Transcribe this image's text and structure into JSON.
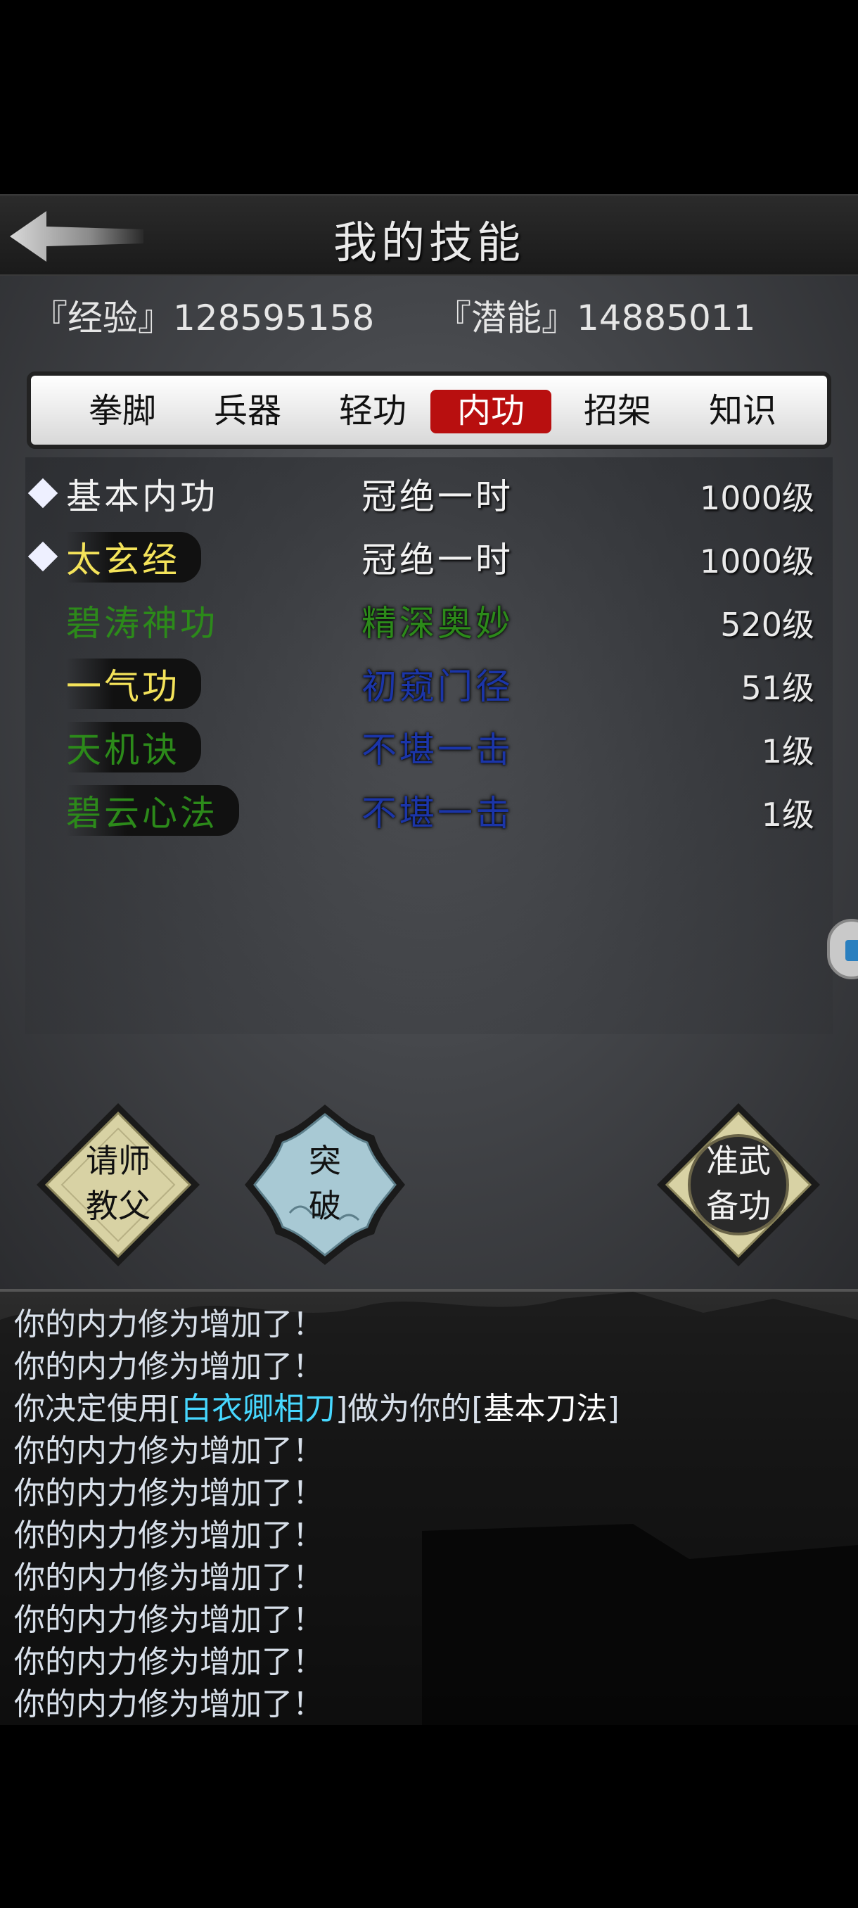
{
  "header": {
    "title": "我的技能"
  },
  "stats": {
    "experience": "『经验』128595158",
    "potential": "『潜能』14885011"
  },
  "tabs": [
    {
      "label": "拳脚",
      "active": false
    },
    {
      "label": "兵器",
      "active": false
    },
    {
      "label": "轻功",
      "active": false
    },
    {
      "label": "内功",
      "active": true
    },
    {
      "label": "招架",
      "active": false
    },
    {
      "label": "知识",
      "active": false
    }
  ],
  "skills": [
    {
      "name": "基本内功",
      "level": "冠绝一时",
      "grade": "1000级",
      "equipped": true,
      "name_color": "#f2f2f2",
      "level_color": "#f2f2f2"
    },
    {
      "name": "太玄经",
      "level": "冠绝一时",
      "grade": "1000级",
      "equipped": true,
      "name_color": "#f4e35a",
      "level_color": "#f2f2f2"
    },
    {
      "name": "碧涛神功",
      "level": "精深奥妙",
      "grade": "520级",
      "equipped": false,
      "name_color": "#2c8a1a",
      "level_color": "#2c8a1a"
    },
    {
      "name": "一气功",
      "level": "初窥门径",
      "grade": "51级",
      "equipped": false,
      "name_color": "#f4e35a",
      "level_color": "#1b35a8"
    },
    {
      "name": "天机诀",
      "level": "不堪一击",
      "grade": "1级",
      "equipped": false,
      "name_color": "#2c8a1a",
      "level_color": "#1b35a8"
    },
    {
      "name": "碧云心法",
      "level": "不堪一击",
      "grade": "1级",
      "equipped": false,
      "name_color": "#2c8a1a",
      "level_color": "#1b35a8"
    }
  ],
  "actions": {
    "teacher": [
      "请师",
      "教父"
    ],
    "breakthrough": [
      "突",
      "破"
    ],
    "prepare": [
      "准武",
      "备功"
    ]
  },
  "log": [
    "你的内力修为增加了！",
    "你的内力修为增加了！",
    {
      "prefix": "你决定使用[",
      "highlight": "白衣卿相刀",
      "middle": "]做为你的[",
      "highlight2": "基本刀法",
      "suffix": "]"
    },
    "你的内力修为增加了！",
    "你的内力修为增加了！",
    "你的内力修为增加了！",
    "你的内力修为增加了！",
    "你的内力修为增加了！",
    "你的内力修为增加了！",
    "你的内力修为增加了！"
  ]
}
